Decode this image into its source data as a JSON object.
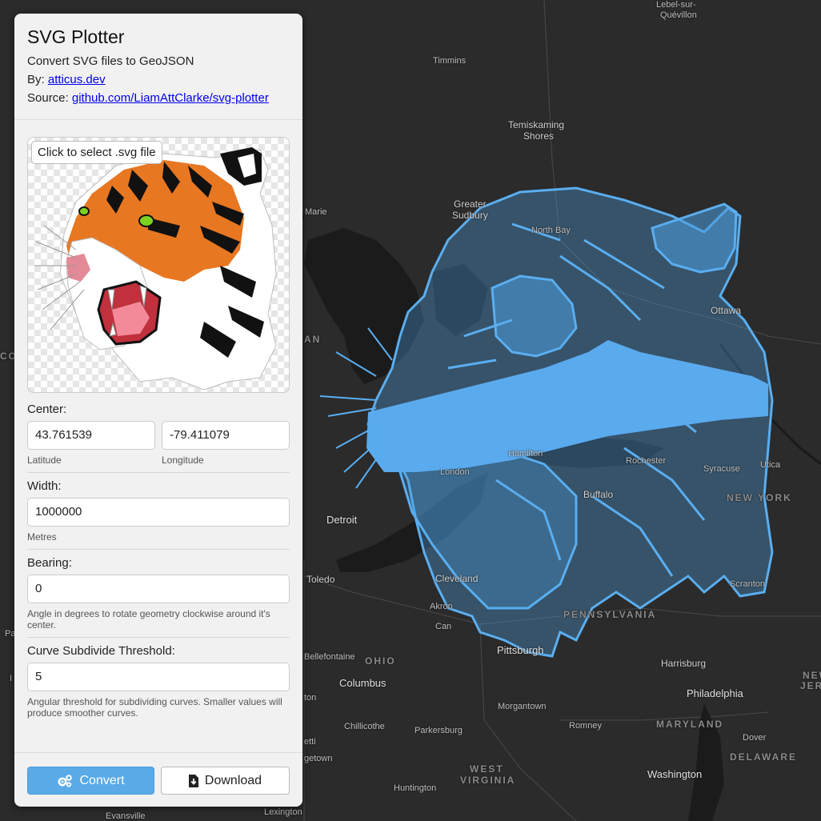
{
  "panel": {
    "title": "SVG Plotter",
    "subtitle": "Convert SVG files to GeoJSON",
    "by_label": "By:",
    "by_link": "atticus.dev",
    "source_label": "Source:",
    "source_link": "github.com/LiamAttClarke/svg-plotter",
    "select_file_label": "Click to select .svg file",
    "center_label": "Center:",
    "latitude_value": "43.761539",
    "latitude_label": "Latitude",
    "longitude_value": "-79.411079",
    "longitude_label": "Longitude",
    "width_label": "Width:",
    "width_value": "1000000",
    "width_unit": "Metres",
    "bearing_label": "Bearing:",
    "bearing_value": "0",
    "bearing_hint": "Angle in degrees to rotate geometry clockwise around it's center.",
    "curve_label": "Curve Subdivide Threshold:",
    "curve_value": "5",
    "curve_hint": "Angular threshold for subdividing curves. Smaller values will produce smoother curves.",
    "convert_label": "Convert",
    "download_label": "Download"
  },
  "icons": {
    "convert": "gears-icon",
    "download": "file-download-icon"
  },
  "colors": {
    "accent": "#5aaae8",
    "overlay": "#4a9ee0",
    "map_bg": "#2b2b2b"
  },
  "map": {
    "labels": {
      "lebel": "Lebel-sur-",
      "quevillon": "Quévillon",
      "timmins": "Timmins",
      "temiskaming1": "Temiskaming",
      "temiskaming2": "Shores",
      "greater": "Greater",
      "sudbury": "Sudbury",
      "marie": "Marie",
      "northbay": "North Bay",
      "ottawa": "Ottawa",
      "an": "AN",
      "co": "CO",
      "detroit": "Detroit",
      "toledo": "Toledo",
      "london": "London",
      "hamilton": "Hamilton",
      "rochester": "Rochester",
      "syracuse": "Syracuse",
      "utica": "Utica",
      "buffalo": "Buffalo",
      "newyork": "NEW YORK",
      "cleveland": "Cleveland",
      "akron": "Akron",
      "canton": "Can",
      "pennsylvania": "PENNSYLVANIA",
      "scranton": "Scranton",
      "pittsburgh": "Pittsburgh",
      "ohio": "OHIO",
      "bellefontaine": "Bellefontaine",
      "columbus": "Columbus",
      "harrisburg": "Harrisburg",
      "philadelphia": "Philadelphia",
      "newjersey1": "NEW",
      "newjersey2": "JERS",
      "morgantown": "Morgantown",
      "chillicothe": "Chillicothe",
      "parkersburg": "Parkersburg",
      "romney": "Romney",
      "maryland": "MARYLAND",
      "dover": "Dover",
      "delaware": "DELAWARE",
      "wv1": "WEST",
      "wv2": "VIRGINIA",
      "washington": "Washington",
      "huntington": "Huntington",
      "lexington": "Lexington",
      "evansville": "Evansville",
      "ton": "ton",
      "getown": "getown",
      "etti": "etti",
      "pa": "Pa",
      "i": "I"
    }
  }
}
